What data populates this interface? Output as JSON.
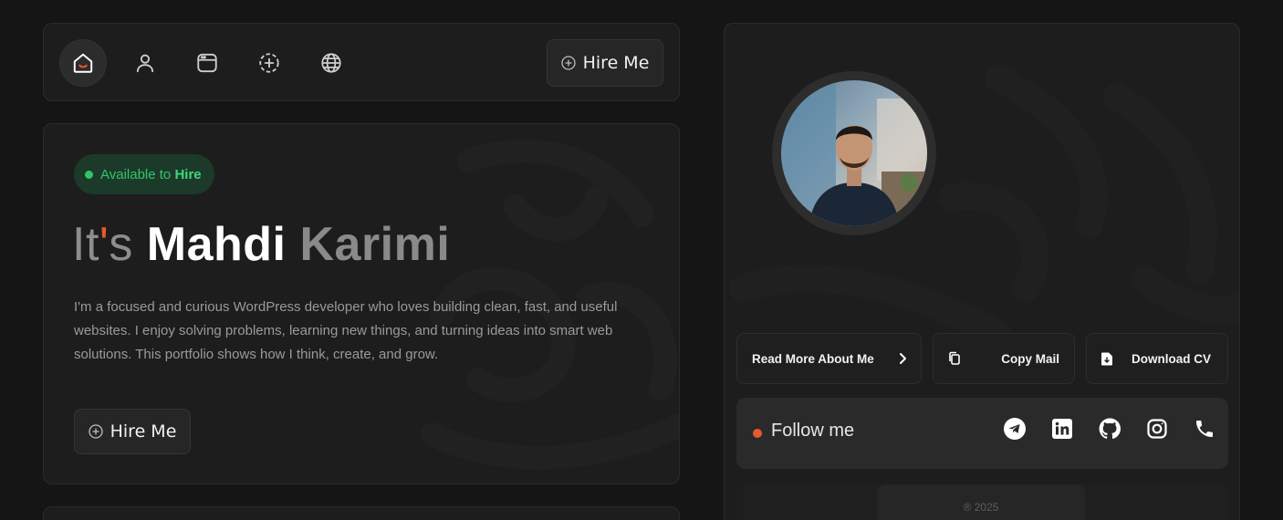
{
  "nav": {
    "items": [
      {
        "name": "home",
        "icon": "home-icon",
        "active": true
      },
      {
        "name": "about",
        "icon": "user-icon",
        "active": false
      },
      {
        "name": "portfolio",
        "icon": "browser-window-icon",
        "active": false
      },
      {
        "name": "services",
        "icon": "dashed-plus-circle-icon",
        "active": false
      },
      {
        "name": "contact",
        "icon": "globe-icon",
        "active": false
      }
    ],
    "hire_label": "Hire Me"
  },
  "hero": {
    "badge_prefix": "Available to",
    "badge_emphasis": "Hire",
    "title_its": "It",
    "title_apos": "'",
    "title_s": "s",
    "first_name": "Mahdi",
    "last_name": "Karimi",
    "description": "I'm a focused and curious WordPress developer who loves building clean, fast, and useful websites. I enjoy solving problems, learning new things, and turning ideas into smart web solutions. This portfolio shows how I think, create, and grow.",
    "hire_label": "Hire Me"
  },
  "profile": {
    "actions": {
      "read_more": "Read More About Me",
      "copy_mail": "Copy Mail",
      "download_cv": "Download CV"
    },
    "follow_label": "Follow me",
    "socials": [
      "telegram-icon",
      "linkedin-icon",
      "github-icon",
      "instagram-icon",
      "phone-icon"
    ],
    "footer_text": "® 2025"
  },
  "colors": {
    "background": "#151515",
    "card": "#1d1d1d",
    "accent": "#e85a2c",
    "available": "#33c46b"
  }
}
